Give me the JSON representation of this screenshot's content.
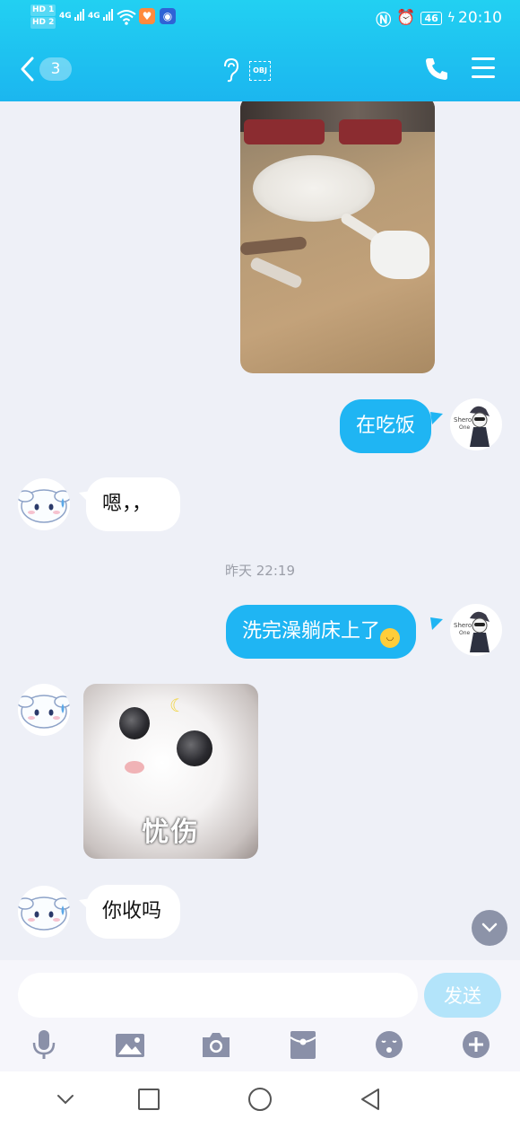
{
  "status_bar": {
    "hd1": "HD 1",
    "hd2": "HD 2",
    "sim1_network": "4G",
    "sim2_network": "4G",
    "battery_level": "46",
    "time": "20:10"
  },
  "nav": {
    "unread_count": "3",
    "obj_label": "OBJ"
  },
  "messages": [
    {
      "direction": "out",
      "type": "image"
    },
    {
      "direction": "out",
      "type": "text",
      "text": "在吃饭"
    },
    {
      "direction": "in",
      "type": "text",
      "text": "嗯，，"
    },
    {
      "direction": "out",
      "type": "text",
      "text": "洗完澡躺床上了"
    },
    {
      "direction": "in",
      "type": "sticker",
      "caption": "忧伤"
    },
    {
      "direction": "in",
      "type": "text",
      "text": "你收吗"
    }
  ],
  "timestamp": "昨天 22:19",
  "input": {
    "placeholder": "",
    "value": "",
    "send_label": "发送"
  },
  "toolbar_icons": [
    "mic-icon",
    "image-icon",
    "camera-icon",
    "red-packet-icon",
    "emoji-icon",
    "plus-icon"
  ],
  "colors": {
    "header": "#1fbdf1",
    "out_bubble": "#1fb5f3",
    "send_button": "#b3e4fa",
    "chat_bg": "#eef0f7"
  }
}
